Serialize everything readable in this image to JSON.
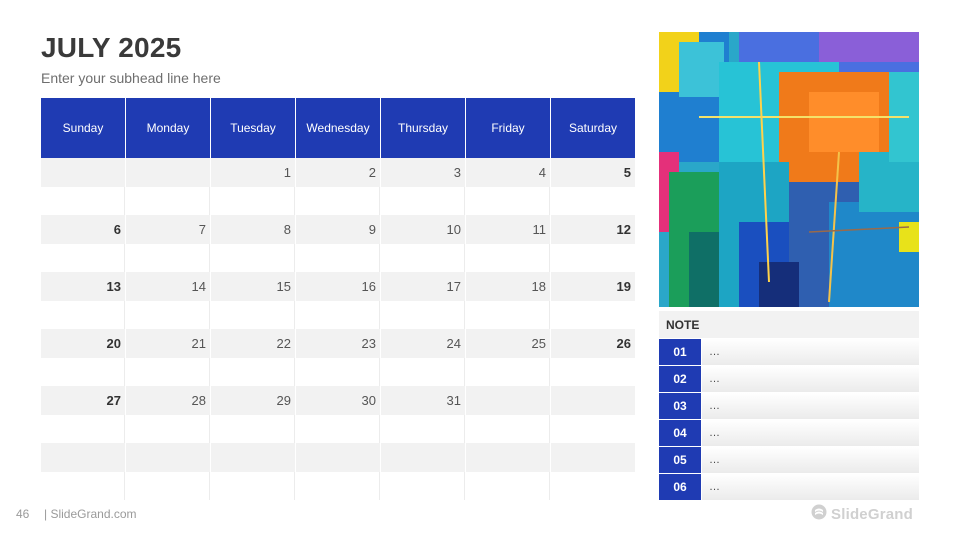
{
  "title": "JULY 2025",
  "subhead": "Enter your subhead line here",
  "calendar": {
    "days": [
      "Sunday",
      "Monday",
      "Tuesday",
      "Wednesday",
      "Thursday",
      "Friday",
      "Saturday"
    ],
    "weeks": [
      [
        "",
        "",
        "1",
        "2",
        "3",
        "4",
        "5"
      ],
      [
        "6",
        "7",
        "8",
        "9",
        "10",
        "11",
        "12"
      ],
      [
        "13",
        "14",
        "15",
        "16",
        "17",
        "18",
        "19"
      ],
      [
        "20",
        "21",
        "22",
        "23",
        "24",
        "25",
        "26"
      ],
      [
        "27",
        "28",
        "29",
        "30",
        "31",
        "",
        ""
      ],
      [
        "",
        "",
        "",
        "",
        "",
        "",
        ""
      ]
    ]
  },
  "notes": {
    "heading": "NOTE",
    "items": [
      {
        "num": "01",
        "text": "…"
      },
      {
        "num": "02",
        "text": "…"
      },
      {
        "num": "03",
        "text": "…"
      },
      {
        "num": "04",
        "text": "…"
      },
      {
        "num": "05",
        "text": "…"
      },
      {
        "num": "06",
        "text": "…"
      }
    ]
  },
  "footer": {
    "page_number": "46",
    "site": "| SlideGrand.com",
    "logo_text": "SlideGrand"
  },
  "colors": {
    "accent": "#1f3bb3",
    "band": "#f2f2f2",
    "title": "#3a3a3a"
  },
  "icons": {
    "logo": "slidegrand-logo-icon",
    "photo": "abstract-painting-image"
  }
}
